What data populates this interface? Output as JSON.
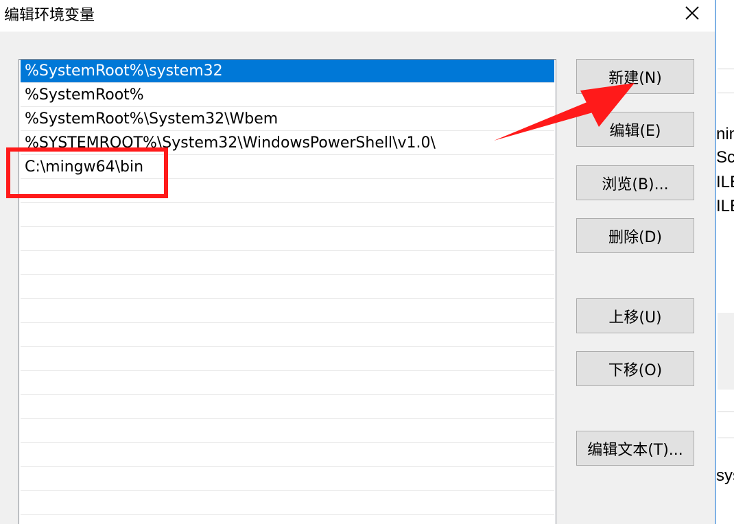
{
  "window": {
    "title": "编辑环境变量"
  },
  "path_list": {
    "items": [
      "%SystemRoot%\\system32",
      "%SystemRoot%",
      "%SystemRoot%\\System32\\Wbem",
      "%SYSTEMROOT%\\System32\\WindowsPowerShell\\v1.0\\",
      "C:\\mingw64\\bin"
    ],
    "selected_index": 0
  },
  "buttons": {
    "new": "新建(N)",
    "edit": "编辑(E)",
    "browse": "浏览(B)...",
    "delete": "删除(D)",
    "move_up": "上移(U)",
    "move_down": "下移(O)",
    "edit_text": "编辑文本(T)..."
  },
  "background_window": {
    "fragments": [
      "nin",
      "Scr",
      "ILE",
      "ILE",
      "sys"
    ]
  },
  "colors": {
    "selection": "#0078d7",
    "annotation": "#ff1a1a",
    "button_face": "#e1e1e1",
    "dialog_bg": "#f0f0f0"
  },
  "icons": {
    "close": "close-icon"
  }
}
